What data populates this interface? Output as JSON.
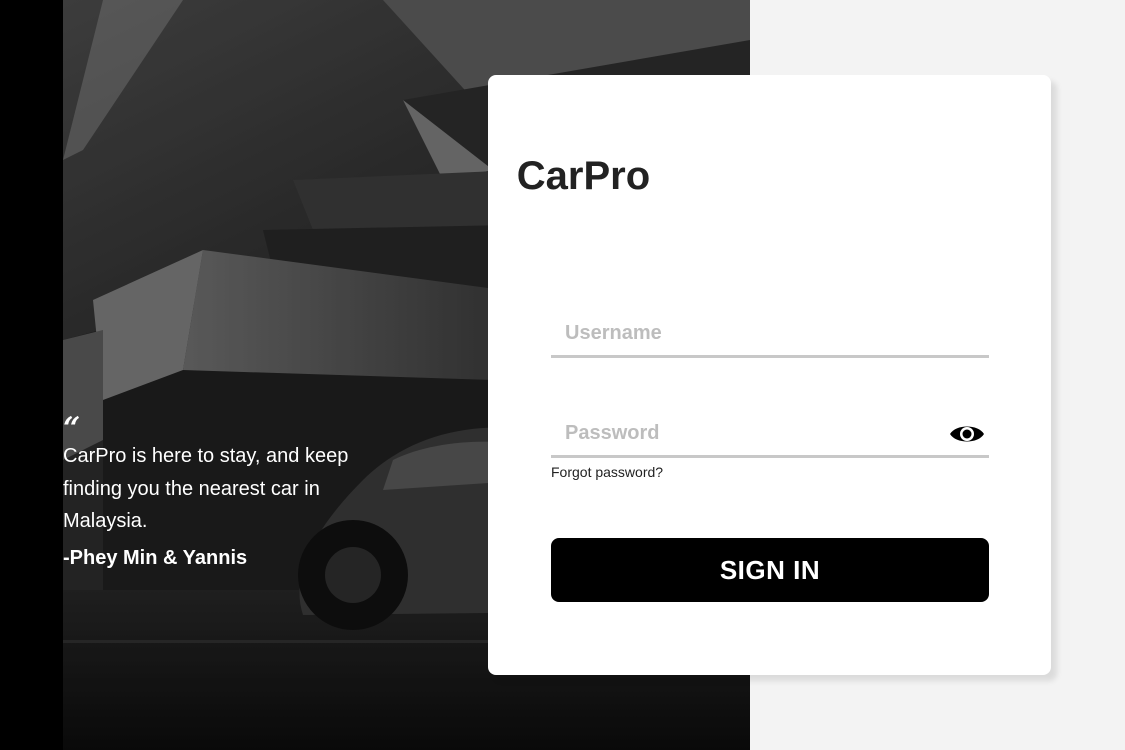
{
  "brand": {
    "title": "CarPro"
  },
  "login": {
    "username_placeholder": "Username",
    "username_value": "",
    "password_placeholder": "Password",
    "password_value": "",
    "forgot_label": "Forgot password?",
    "signin_label": "SIGN IN"
  },
  "testimonial": {
    "quote_mark": "“",
    "text": "CarPro is here to stay, and keep finding you the nearest car in Malaysia.",
    "author": "-Phey Min & Yannis"
  },
  "icons": {
    "password_toggle": "eye-icon"
  },
  "colors": {
    "primary_button": "#000000",
    "card_background": "#ffffff",
    "page_background": "#f3f3f3",
    "input_underline": "#c8c8c8",
    "placeholder": "#bdbdbd"
  }
}
